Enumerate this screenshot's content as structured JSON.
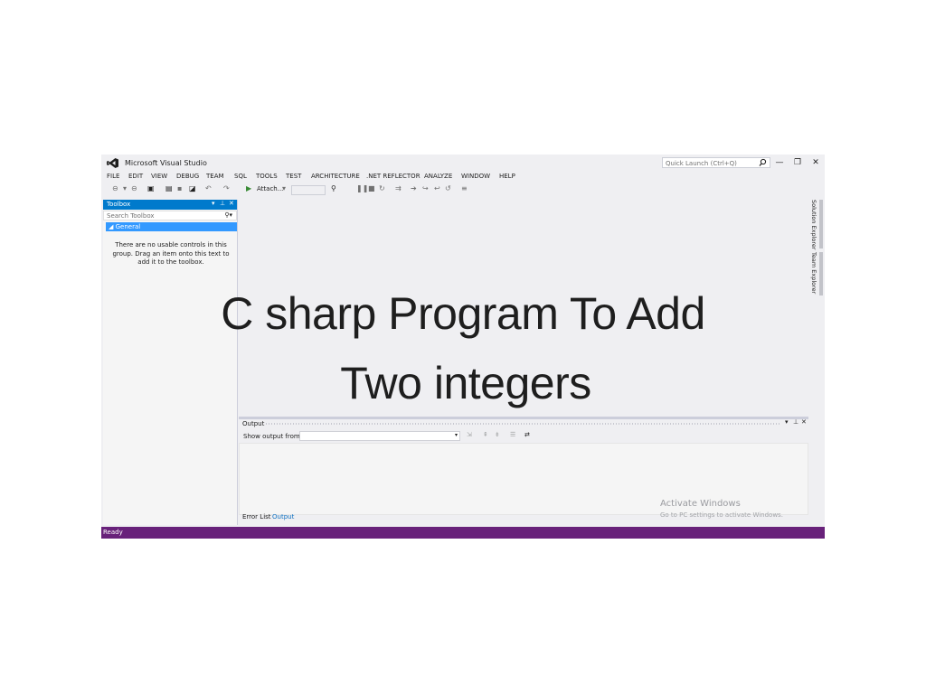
{
  "app": {
    "title": "Microsoft Visual Studio",
    "quick_launch_placeholder": "Quick Launch (Ctrl+Q)",
    "window_controls": [
      "—",
      "❐",
      "✕"
    ]
  },
  "menu": [
    "FILE",
    "EDIT",
    "VIEW",
    "DEBUG",
    "TEAM",
    "SQL",
    "TOOLS",
    "TEST",
    "ARCHITECTURE",
    ".NET REFLECTOR",
    "ANALYZE",
    "WINDOW",
    "HELP"
  ],
  "toolbar": {
    "attach_label": "Attach..."
  },
  "toolbox": {
    "title": "Toolbox",
    "search_placeholder": "Search Toolbox",
    "group": "◢ General",
    "empty_message": "There are no usable controls in this group. Drag an item onto this text to add it to the toolbox."
  },
  "side_tabs": [
    "Solution Explorer",
    "Team Explorer"
  ],
  "output": {
    "title": "Output",
    "show_output_from": "Show output from:",
    "tabs": [
      "Error List",
      "Output"
    ]
  },
  "watermark": {
    "line1": "Activate Windows",
    "line2": "Go to PC settings to activate Windows."
  },
  "status": "Ready",
  "overlay": {
    "line1": "C sharp Program To Add",
    "line2": "Two integers"
  },
  "colors": {
    "accent": "#007acc",
    "status_bar": "#68217a",
    "selected_group": "#3399ff",
    "ide_background": "#efeff2"
  }
}
